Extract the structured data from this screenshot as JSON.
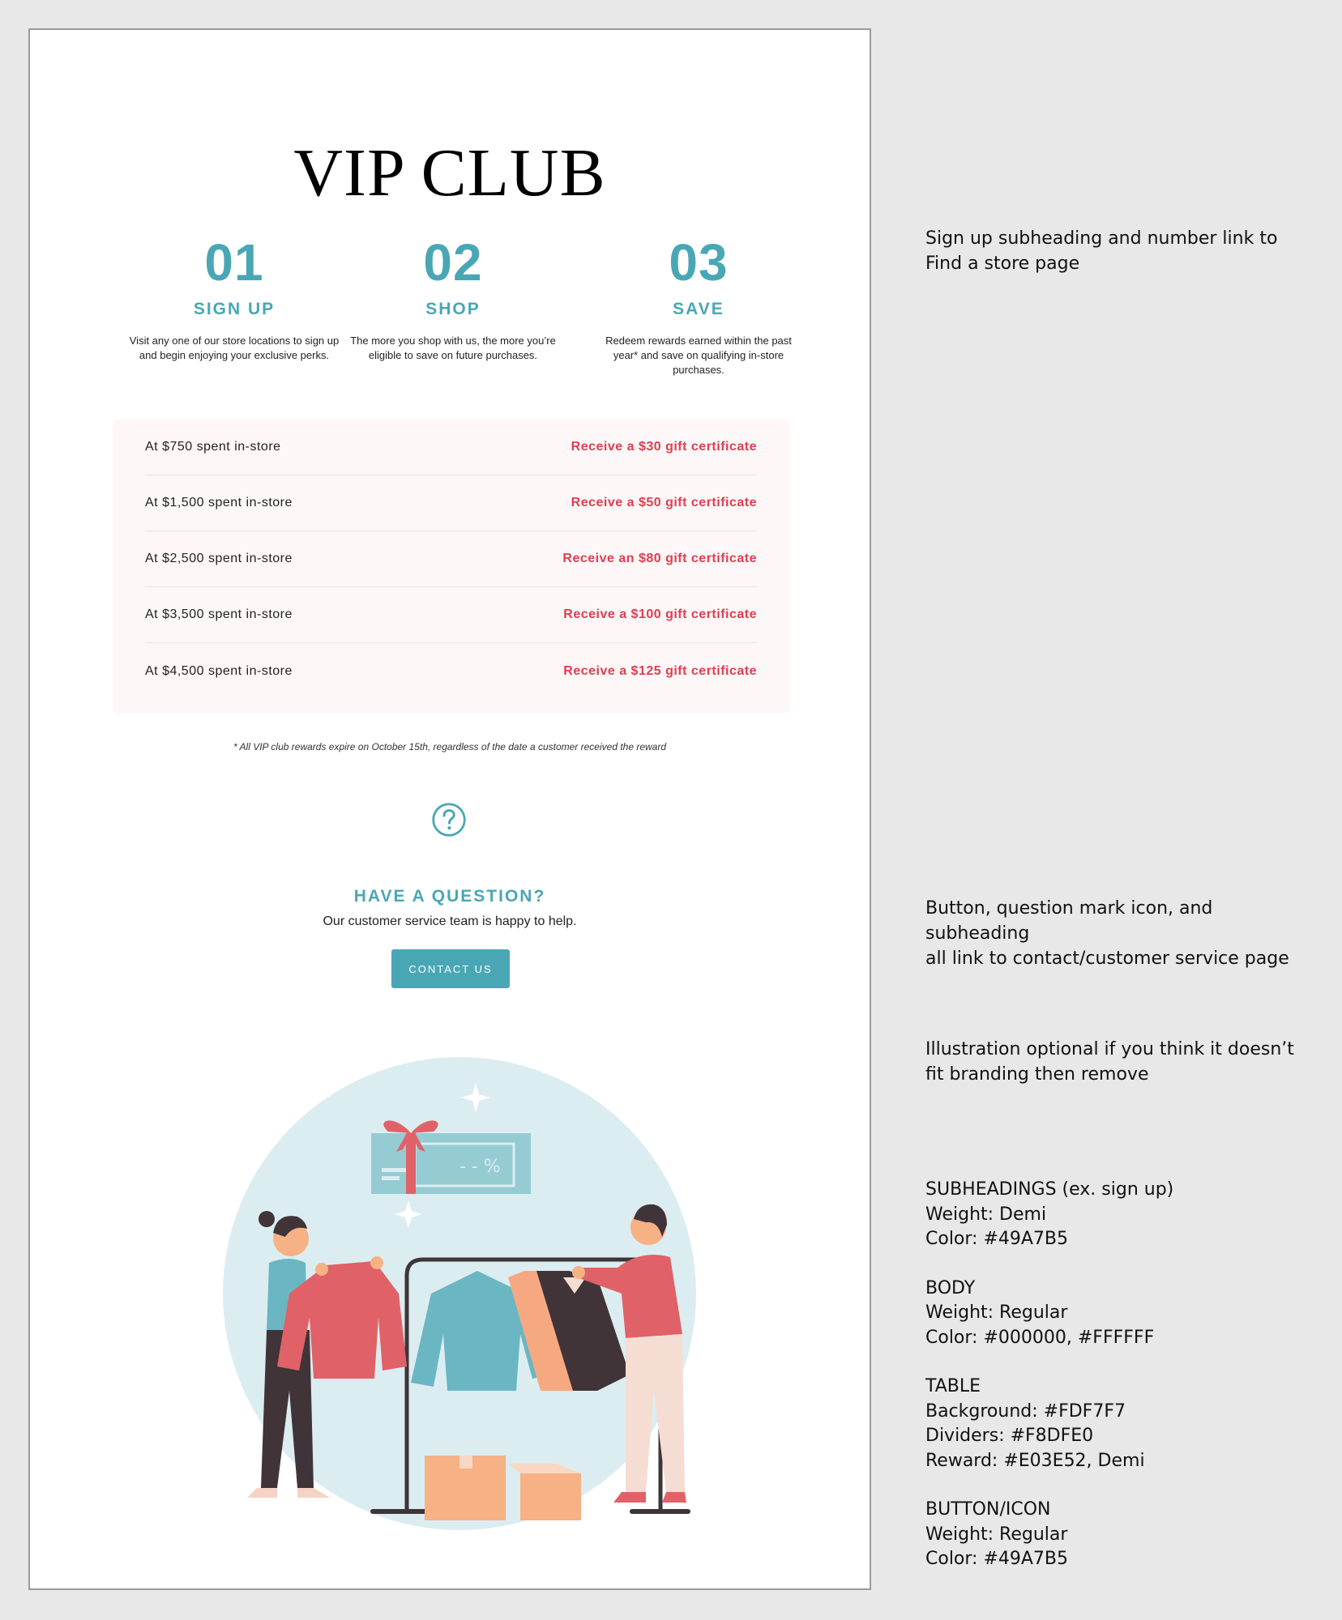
{
  "email": {
    "title": "VIP CLUB",
    "steps": [
      {
        "number": "01",
        "heading": "SIGN UP",
        "body": "Visit any one of our store locations to sign up and begin enjoying your exclusive perks."
      },
      {
        "number": "02",
        "heading": "SHOP",
        "body": "The more you shop with us, the more you’re eligible to save on future purchases."
      },
      {
        "number": "03",
        "heading": "SAVE",
        "body": "Redeem rewards earned within the past year* and save on qualifying in-store purchases."
      }
    ],
    "rewards": [
      {
        "spent": "At $750 spent in-store",
        "reward": "Receive a $30 gift certificate"
      },
      {
        "spent": "At $1,500 spent in-store",
        "reward": "Receive a $50 gift certificate"
      },
      {
        "spent": "At $2,500 spent in-store",
        "reward": "Receive an $80 gift certificate"
      },
      {
        "spent": "At $3,500 spent in-store",
        "reward": "Receive a $100 gift certificate"
      },
      {
        "spent": "At $4,500 spent in-store",
        "reward": "Receive a $125 gift certificate"
      }
    ],
    "footnote": "* All VIP club rewards expire on October 15th, regardless of the date a customer received the reward",
    "question": {
      "icon": "question-mark-icon",
      "heading": "HAVE A QUESTION?",
      "body": "Our customer service team is happy to help.",
      "button": "CONTACT US"
    },
    "illustration": "shopping-rack-illustration"
  },
  "notes": {
    "signup": [
      "Sign up subheading and number link to",
      "Find a store page"
    ],
    "contact": [
      "Button, question mark icon, and subheading",
      "all link to contact/customer service page"
    ],
    "illustration": [
      "Illustration optional if you think it doesn’t",
      "fit branding then remove"
    ]
  },
  "specs": {
    "subheadings": [
      "SUBHEADINGS (ex. sign up)",
      "Weight: Demi",
      "Color: #49A7B5"
    ],
    "body": [
      "BODY",
      "Weight: Regular",
      "Color: #000000, #FFFFFF"
    ],
    "table": [
      "TABLE",
      "Background: #FDF7F7",
      "Dividers: #F8DFE0",
      "Reward: #E03E52, Demi"
    ],
    "button": [
      "BUTTON/ICON",
      "Weight: Regular",
      "Color: #49A7B5"
    ]
  },
  "colors": {
    "accent": "#49A7B5",
    "reward": "#E03E52",
    "table_bg": "#FDF7F7",
    "table_divider": "#F8DFE0"
  }
}
